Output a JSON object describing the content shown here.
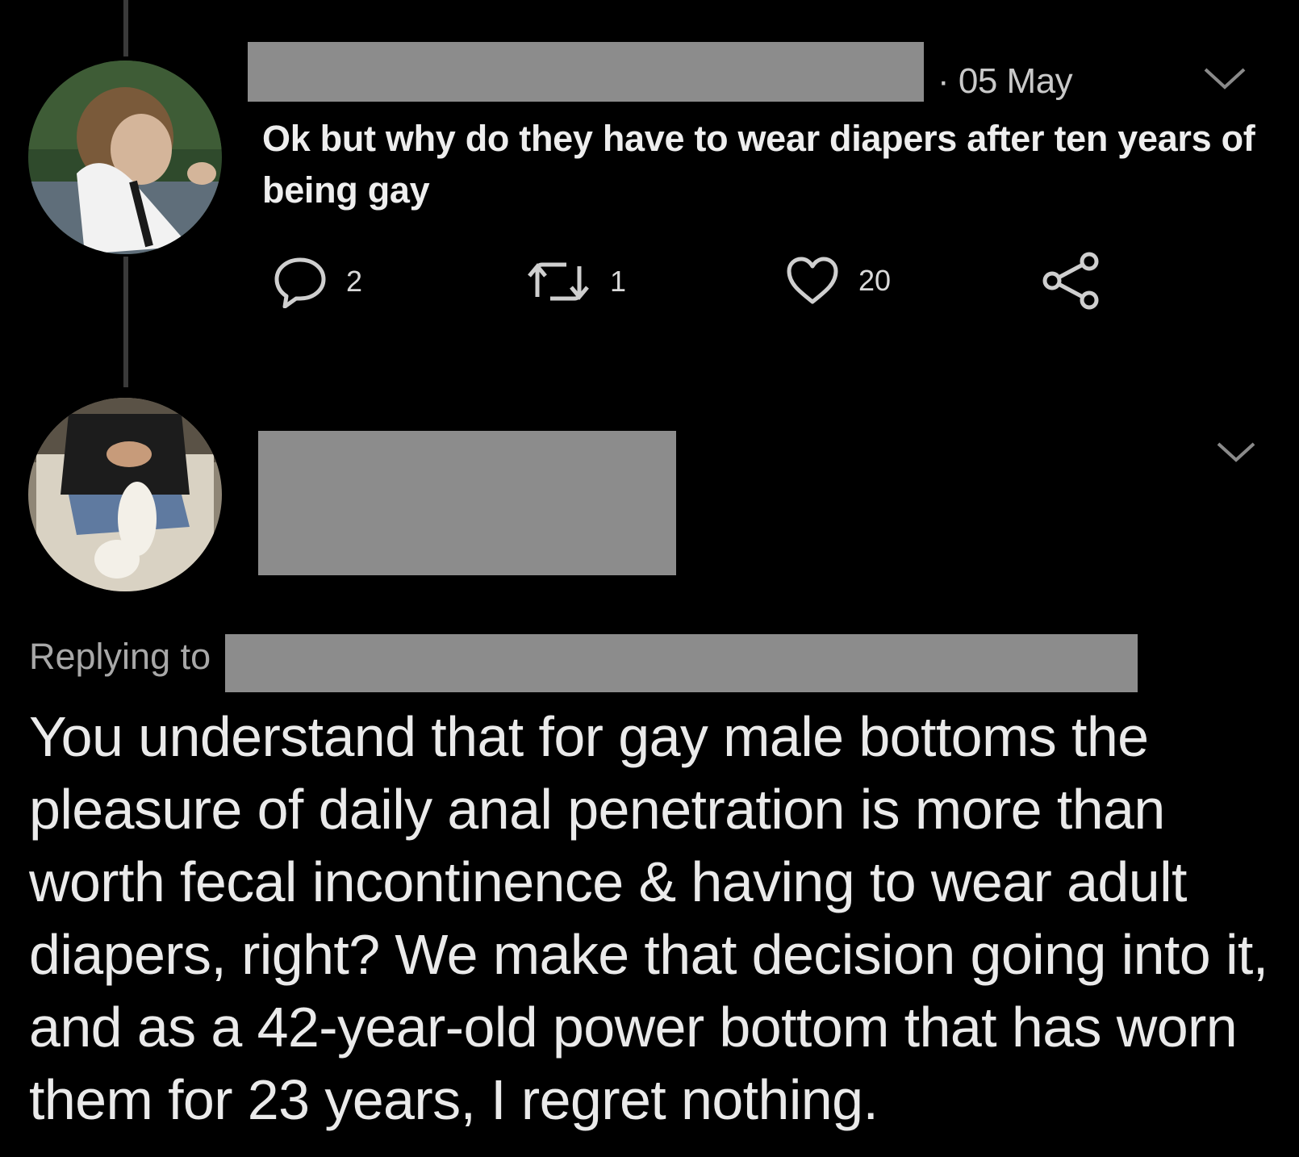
{
  "tweet": {
    "date": "· 05 May",
    "text": "Ok but why do they have to wear diapers after ten years of being gay",
    "actions": {
      "reply_count": "2",
      "retweet_count": "1",
      "like_count": "20"
    }
  },
  "reply": {
    "replying_label": "Replying to",
    "text": "You understand that for gay male bottoms the pleasure of daily anal penetration is more than worth fecal incontinence & having to wear adult diapers, right? We make that decision going into it, and as a 42-year-old power bottom that has worn them for 23 years, I regret nothing."
  },
  "colors": {
    "background": "#000000",
    "redaction": "#8c8c8c",
    "text": "#e6e6e6"
  }
}
